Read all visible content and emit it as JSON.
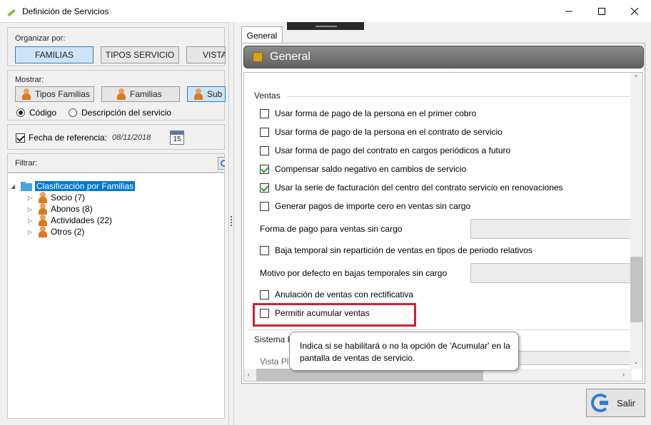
{
  "window": {
    "title": "Definición de Servicios",
    "controls": {
      "minimize": "—",
      "maximize": "☐",
      "close": "✕"
    }
  },
  "left": {
    "organizar": {
      "label": "Organizar por:",
      "buttons": [
        {
          "label": "FAMILIAS",
          "active": true
        },
        {
          "label": "TIPOS SERVICIO",
          "active": false
        },
        {
          "label": "VISTA",
          "active": false
        }
      ]
    },
    "mostrar": {
      "label": "Mostrar:",
      "buttons": [
        {
          "label": "Tipos Familias",
          "active": false
        },
        {
          "label": "Familias",
          "active": false
        },
        {
          "label": "Sub",
          "active": true
        }
      ],
      "radios": [
        {
          "label": "Código",
          "checked": true
        },
        {
          "label": "Descripción del servicio",
          "checked": false
        }
      ]
    },
    "fecha": {
      "label": "Fecha de referencia:",
      "value": "08/11/2018",
      "checked": true,
      "calendar_day": "15"
    },
    "filtrar": {
      "label": "Filtrar:"
    },
    "tree": {
      "root": "Clasificación por Familias",
      "items": [
        {
          "label": "Socio (7)"
        },
        {
          "label": "Abonos (8)"
        },
        {
          "label": "Actividades (22)"
        },
        {
          "label": "Otros (2)"
        }
      ]
    }
  },
  "right": {
    "tab": "General",
    "header": "General",
    "ventas": {
      "label": "Ventas",
      "options": [
        {
          "label": "Usar forma de pago de la persona en el primer cobro",
          "checked": false
        },
        {
          "label": "Usar forma de pago de la persona en el contrato de servicio",
          "checked": false
        },
        {
          "label": "Usar forma de pago del contrato en cargos periódicos a futuro",
          "checked": false
        },
        {
          "label": "Compensar saldo negativo en cambios de servicio",
          "checked": true
        },
        {
          "label": "Usar la serie de facturación del centro del contrato servicio en renovaciones",
          "checked": true
        },
        {
          "label": "Generar pagos de importe cero en ventas sin cargo",
          "checked": false
        }
      ],
      "forma_pago_label": "Forma de pago para ventas sin cargo",
      "baja_temporal": {
        "label": "Baja temporal sin repartición de ventas en tipos de periodo relativos",
        "checked": false
      },
      "motivo_label": "Motivo por defecto en bajas temporales sin cargo",
      "anulacion": {
        "label": "Anulación de ventas con rectificativa",
        "checked": false
      },
      "acumular": {
        "label": "Permitir acumular ventas",
        "checked": false
      }
    },
    "sistema_label": "Sistema Re",
    "partial_label": "Vista Pl",
    "tooltip": "Indica si se habilitará o no la opción de 'Acumular' en la pantalla de ventas de servicio.",
    "salir": "Salir"
  },
  "colors": {
    "accent": "#cce4f7",
    "highlight": "#d0212a",
    "check_green": "#1f9e3a",
    "tree_selected": "#0078d7"
  },
  "icons": [
    "pencil-icon",
    "person-icon",
    "calendar-icon",
    "search-icon",
    "folder-icon",
    "gold-box-icon",
    "exit-icon"
  ]
}
